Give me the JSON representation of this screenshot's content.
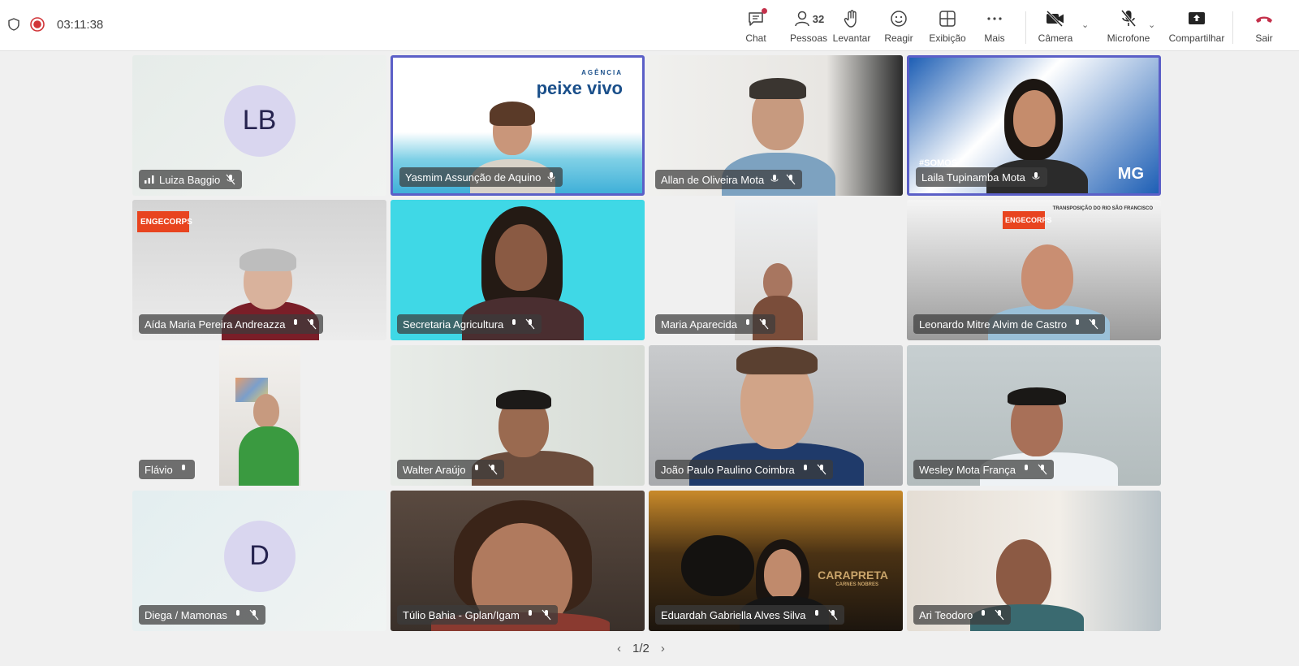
{
  "topbar": {
    "timer": "03:11:38",
    "buttons": {
      "chat": "Chat",
      "people": "Pessoas",
      "people_count": "32",
      "raise": "Levantar",
      "react": "Reagir",
      "view": "Exibição",
      "more": "Mais",
      "camera": "Câmera",
      "mic": "Microfone",
      "share": "Compartilhar",
      "leave": "Sair"
    },
    "colors": {
      "recording": "#d13438",
      "leave": "#c4314b",
      "accent": "#5b5fc7"
    }
  },
  "tiles": [
    {
      "name": "Luiza Baggio",
      "initials": "LB"
    },
    {
      "name": "Yasmim Assunção de Aquino",
      "logo": "peixe vivo",
      "logo_top": "AGÊNCIA"
    },
    {
      "name": "Allan de Oliveira Mota"
    },
    {
      "name": "Laila Tupinamba Mota",
      "bg_text": "#SOMOS",
      "bg_text2": "MG"
    },
    {
      "name": "Aída Maria Pereira Andreazza",
      "logo": "ENGECORPS"
    },
    {
      "name": "Secretaria Agricultura"
    },
    {
      "name": "Maria Aparecida"
    },
    {
      "name": "Leonardo Mitre Alvim de Castro",
      "logo": "ENGECORPS",
      "bg_text": "TRANSPOSIÇÃO DO RIO SÃO FRANCISCO"
    },
    {
      "name": "Flávio"
    },
    {
      "name": "Walter Araújo"
    },
    {
      "name": "João Paulo Paulino Coimbra"
    },
    {
      "name": "Wesley Mota França"
    },
    {
      "name": "Diega / Mamonas",
      "initials": "D"
    },
    {
      "name": "Túlio Bahia - Gplan/Igam"
    },
    {
      "name": "Eduardah Gabriella Alves Silva",
      "logo": "CARAPRETA",
      "logo_sub": "CARNES NOBRES"
    },
    {
      "name": "Ari Teodoro"
    }
  ],
  "pager": {
    "label": "1/2"
  }
}
